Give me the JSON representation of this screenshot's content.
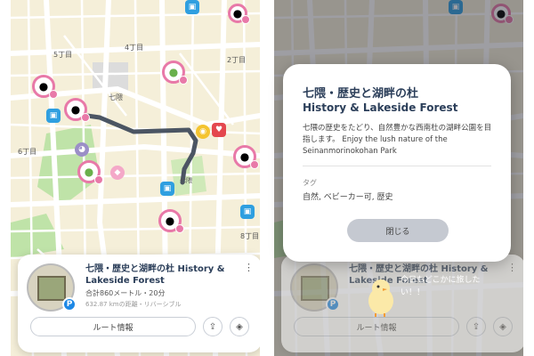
{
  "map": {
    "labels": [
      "5丁目",
      "4丁目",
      "2丁目",
      "七隈",
      "6丁目",
      "8丁目",
      "七隈"
    ],
    "colors": {
      "route": "#4b5563",
      "pin": "#e879a8",
      "badge_blue": "#2f9fe0",
      "badge_red": "#e4474e",
      "badge_yellow": "#f4c430"
    }
  },
  "bottom_card": {
    "title": "七隈・歴史と湖畔の杜 History & Lakeside Forest",
    "meta": "合計860メートル・20分",
    "distance": "632.87 kmの距離・リバーシブル",
    "route_button": "ルート情報",
    "more_icon": "⋮",
    "share_icon": "share-icon",
    "directions_icon": "directions-icon",
    "badge": "P"
  },
  "modal": {
    "title_jp": "七隈・歴史と湖畔の杜",
    "title_en": "History & Lakeside Forest",
    "description": "七隈の歴史をたどり、自然豊かな西南杜の湖畔公園を目指します。 Enjoy the lush nature of the Seinanmorinokohan Park",
    "tag_heading": "タグ",
    "tags": "自然, ベビーカー可, 歴史",
    "close_button": "閉じる"
  },
  "mascot": {
    "speech": "今日もどこかに旅したい！！"
  }
}
